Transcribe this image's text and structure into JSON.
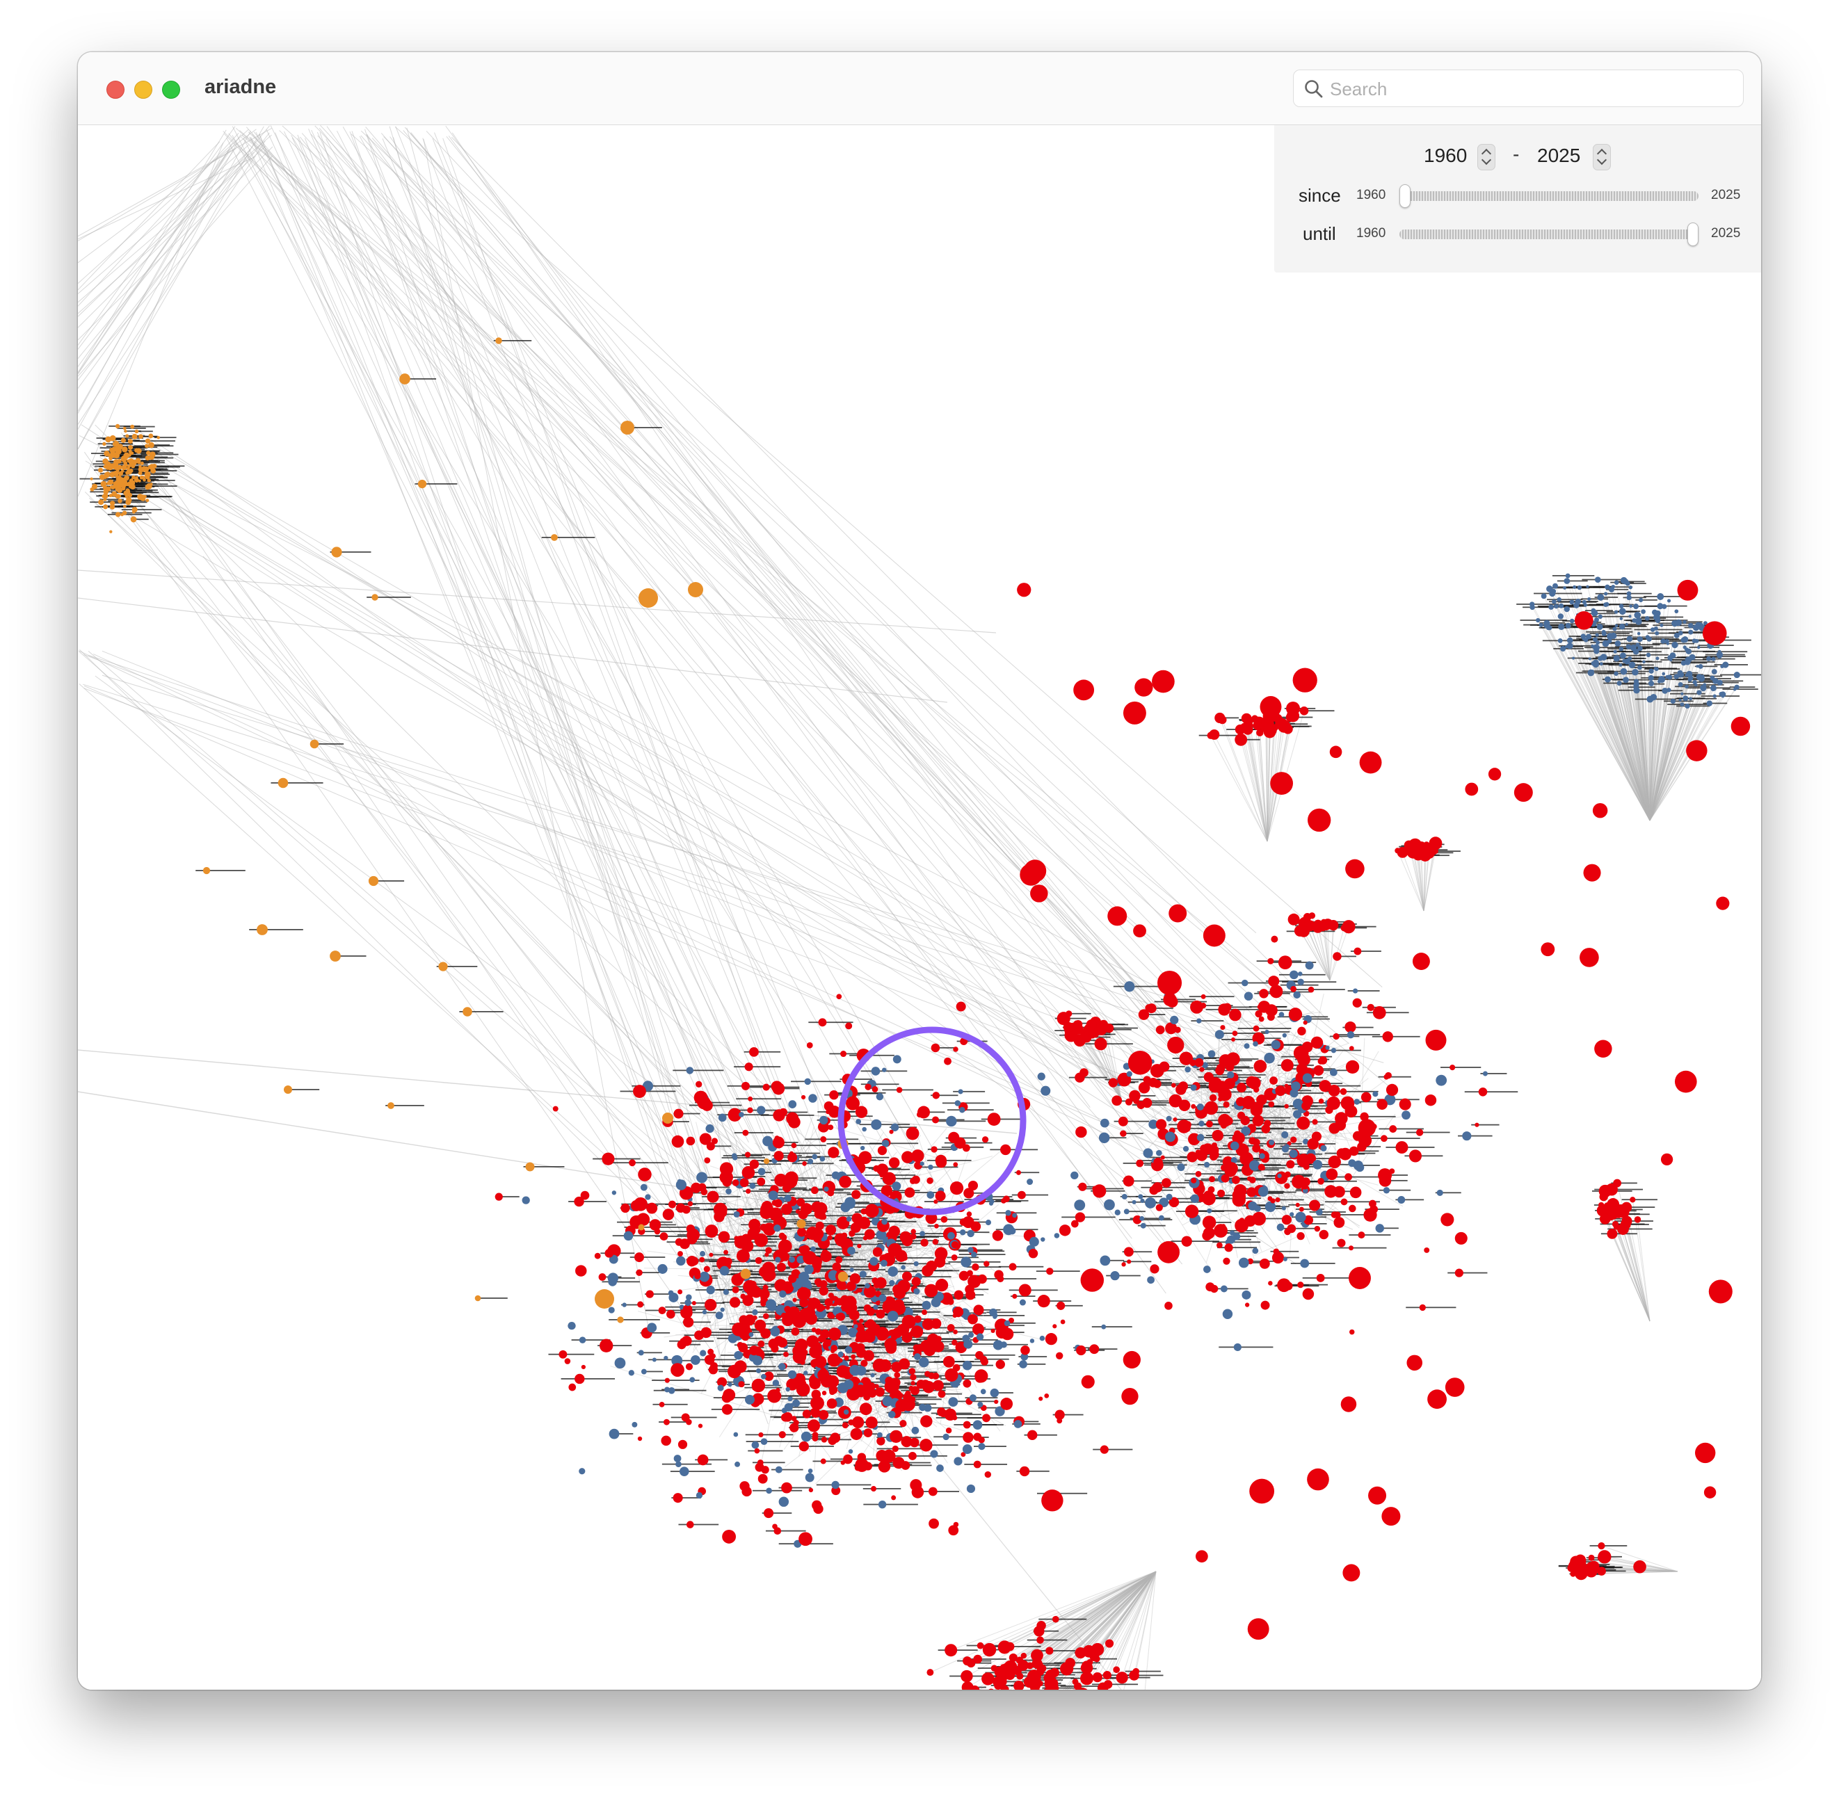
{
  "window": {
    "title": "ariadne",
    "controls": [
      "close",
      "minimize",
      "maximize"
    ]
  },
  "search": {
    "placeholder": "Search",
    "value": "",
    "icon": "search-icon"
  },
  "filter": {
    "since_value": "1960",
    "until_value": "2025",
    "separator": "-",
    "since_label": "since",
    "until_label": "until",
    "min_year": "1960",
    "max_year": "2025",
    "since_slider": {
      "min": 1960,
      "max": 2025,
      "value": 1960
    },
    "until_slider": {
      "min": 1960,
      "max": 2025,
      "value": 2025
    }
  },
  "graph": {
    "colors": {
      "edge": "#b4b4b4",
      "node_orange": "#e8902a",
      "node_red": "#e8000b",
      "node_blue": "#4a6e9c",
      "label_text": "#111111",
      "highlight_ring": "#8b5cf6"
    },
    "highlight": {
      "shape": "circle",
      "color": "#8b5cf6"
    }
  }
}
